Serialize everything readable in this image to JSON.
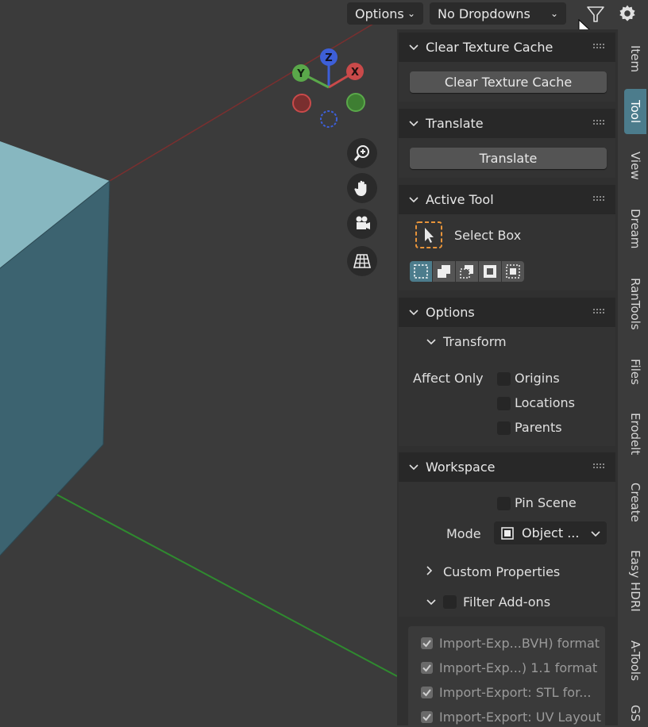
{
  "header": {
    "options_label": "Options",
    "dropdown_label": "No Dropdowns"
  },
  "panels": {
    "clear_cache": {
      "title": "Clear Texture Cache",
      "button": "Clear Texture Cache"
    },
    "translate": {
      "title": "Translate",
      "button": "Translate"
    },
    "active_tool": {
      "title": "Active Tool",
      "tool_name": "Select Box"
    },
    "options": {
      "title": "Options",
      "transform_label": "Transform",
      "affect_only_label": "Affect Only",
      "items": [
        "Origins",
        "Locations",
        "Parents"
      ]
    },
    "workspace": {
      "title": "Workspace",
      "pin_scene": "Pin Scene",
      "mode_label": "Mode",
      "mode_value": "Object ...",
      "custom_properties": "Custom Properties",
      "filter_addons": "Filter Add-ons",
      "addons": [
        "Import-Exp...BVH) format",
        "Import-Exp...) 1.1 format",
        "Import-Export: STL for...",
        "Import-Export: UV Layout"
      ]
    }
  },
  "tabs": [
    "Item",
    "Tool",
    "View",
    "Dream",
    "RanTools",
    "Files",
    "Erodelt",
    "Create",
    "Easy HDRI",
    "A-Tools",
    "GS"
  ],
  "gizmo": {
    "x": "X",
    "y": "Y",
    "z": "Z"
  },
  "colors": {
    "accent": "#4c7c8c",
    "axis_x": "#c94a4a",
    "axis_y": "#5aa84a",
    "axis_z": "#3d5fd8",
    "cube": "#5f8fa0"
  }
}
